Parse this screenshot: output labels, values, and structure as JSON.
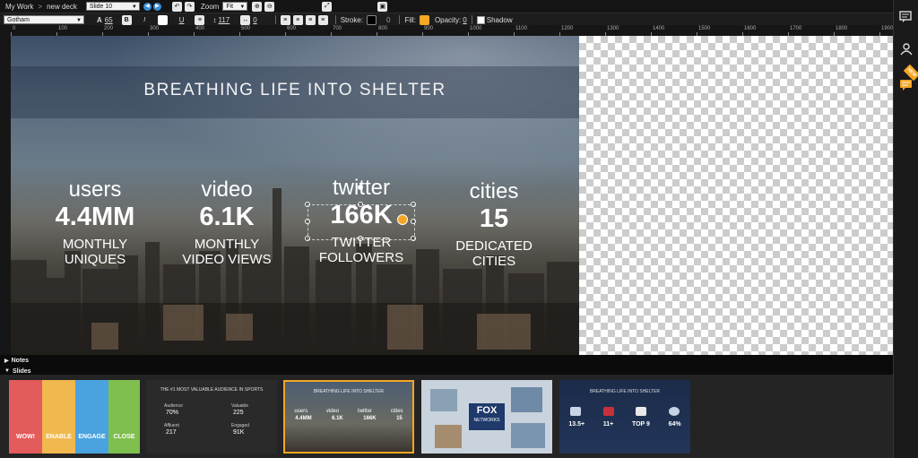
{
  "breadcrumb": {
    "root": "My Work",
    "separator": ">",
    "deck": "new deck"
  },
  "slide_select": {
    "value": "Slide 10"
  },
  "zoom": {
    "label": "Zoom",
    "value": "Fit"
  },
  "format_bar": {
    "font": "Gotham",
    "font_size": "65",
    "bold": "B",
    "italic": "I",
    "underline": "U",
    "line_height": "117",
    "letter_spacing": "0",
    "stroke_label": "Stroke:",
    "stroke_value": "0",
    "fill_label": "Fill:",
    "opacity_label": "Opacity:",
    "opacity_value": "0",
    "shadow_label": "Shadow",
    "fill_color": "#f5a623"
  },
  "ruler": {
    "marks": [
      "0",
      "100",
      "200",
      "300",
      "400",
      "500",
      "600",
      "700",
      "800",
      "900",
      "1000",
      "1100",
      "1200",
      "1300",
      "1400",
      "1500",
      "1600",
      "1700",
      "1800",
      "1900"
    ]
  },
  "slide": {
    "title": "BREATHING LIFE INTO SHELTER",
    "stats": [
      {
        "word": "users",
        "number": "4.4MM",
        "caption_1": "MONTHLY",
        "caption_2": "UNIQUES"
      },
      {
        "word": "video",
        "number": "6.1K",
        "caption_1": "MONTHLY",
        "caption_2": "VIDEO VIEWS"
      },
      {
        "word": "twitter",
        "number": "166K",
        "caption_1": "TWITTER",
        "caption_2": "FOLLOWERS"
      },
      {
        "word": "cities",
        "number": "15",
        "caption_1": "DEDICATED",
        "caption_2": "CITIES"
      }
    ]
  },
  "sections": {
    "notes": "Notes",
    "slides": "Slides"
  },
  "thumbnails": [
    {
      "name": "wow-enable-engage-close",
      "labels": [
        "WOW!",
        "ENABLE",
        "ENGAGE",
        "CLOSE"
      ]
    },
    {
      "name": "valuable-audience",
      "title": "THE #1 MOST VALUABLE AUDIENCE IN SPORTS",
      "labels": [
        "Audience",
        "70%",
        "Valuable",
        "225",
        "Affluent",
        "217",
        "Engaged",
        "91K"
      ]
    },
    {
      "name": "breathing-life",
      "title": "BREATHING LIFE INTO SHELTER",
      "labels": [
        "users",
        "video",
        "twitter",
        "cities",
        "4.4MM",
        "6.1K",
        "166K",
        "15"
      ],
      "active": true
    },
    {
      "name": "fox-networks",
      "labels": [
        "FOX",
        "NETWORKS"
      ]
    },
    {
      "name": "patriots",
      "title": "BREATHING LIFE INTO SHELTER",
      "labels": [
        "13.5+",
        "11+",
        "TOP 9",
        "64%"
      ]
    }
  ],
  "sidebar_icons": [
    "chat-list-icon",
    "people-icon",
    "comment-icon"
  ],
  "sidebar_badge": "NEW"
}
